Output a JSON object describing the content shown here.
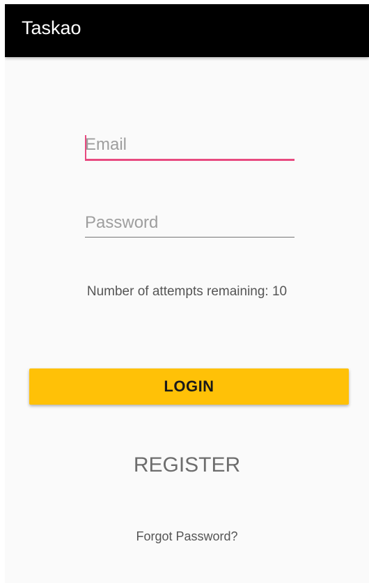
{
  "app_bar": {
    "title": "Taskao"
  },
  "form": {
    "email_placeholder": "Email",
    "password_placeholder": "Password",
    "attempts_text": "Number of attempts remaining: 10"
  },
  "actions": {
    "login_label": "LOGIN",
    "register_label": "REGISTER",
    "forgot_password_label": "Forgot Password?"
  },
  "colors": {
    "app_bar": "#000000",
    "accent": "#e84a80",
    "login_button": "#ffc107",
    "background": "#fafafa"
  }
}
